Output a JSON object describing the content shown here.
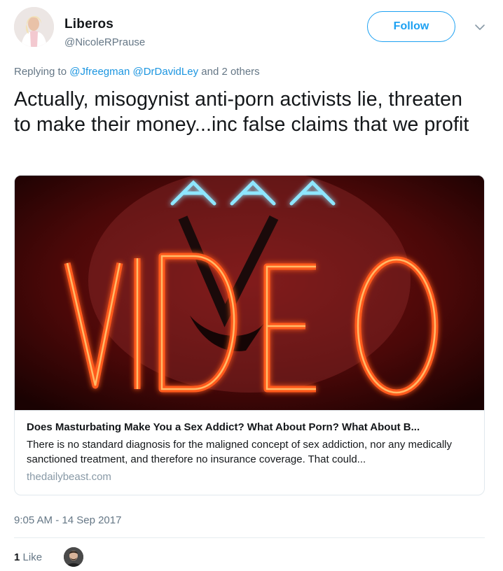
{
  "user": {
    "display_name": "Liberos",
    "handle": "@NicoleRPrause",
    "follow_label": "Follow"
  },
  "reply_context": {
    "prefix": "Replying to",
    "mention_1": "@Jfreegman",
    "mention_2": "@DrDavidLey",
    "suffix": "and 2 others"
  },
  "tweet": {
    "text": "Actually, misogynist anti-porn activists lie, threaten to make their money...inc false claims that we profit"
  },
  "card": {
    "image_text": "VIDEO",
    "title": "Does Masturbating Make You a Sex Addict? What About Porn? What About B...",
    "description": "There is no standard diagnosis for the maligned concept of sex addiction, nor any medically sanctioned treatment, and therefore no insurance coverage. That could...",
    "domain": "thedailybeast.com"
  },
  "meta": {
    "timestamp": "9:05 AM - 14 Sep 2017",
    "like_count": "1",
    "like_label": "Like"
  },
  "colors": {
    "accent": "#1da1f2",
    "link": "#1b95e0",
    "muted": "#657786",
    "neon": "#ff5a1f"
  }
}
